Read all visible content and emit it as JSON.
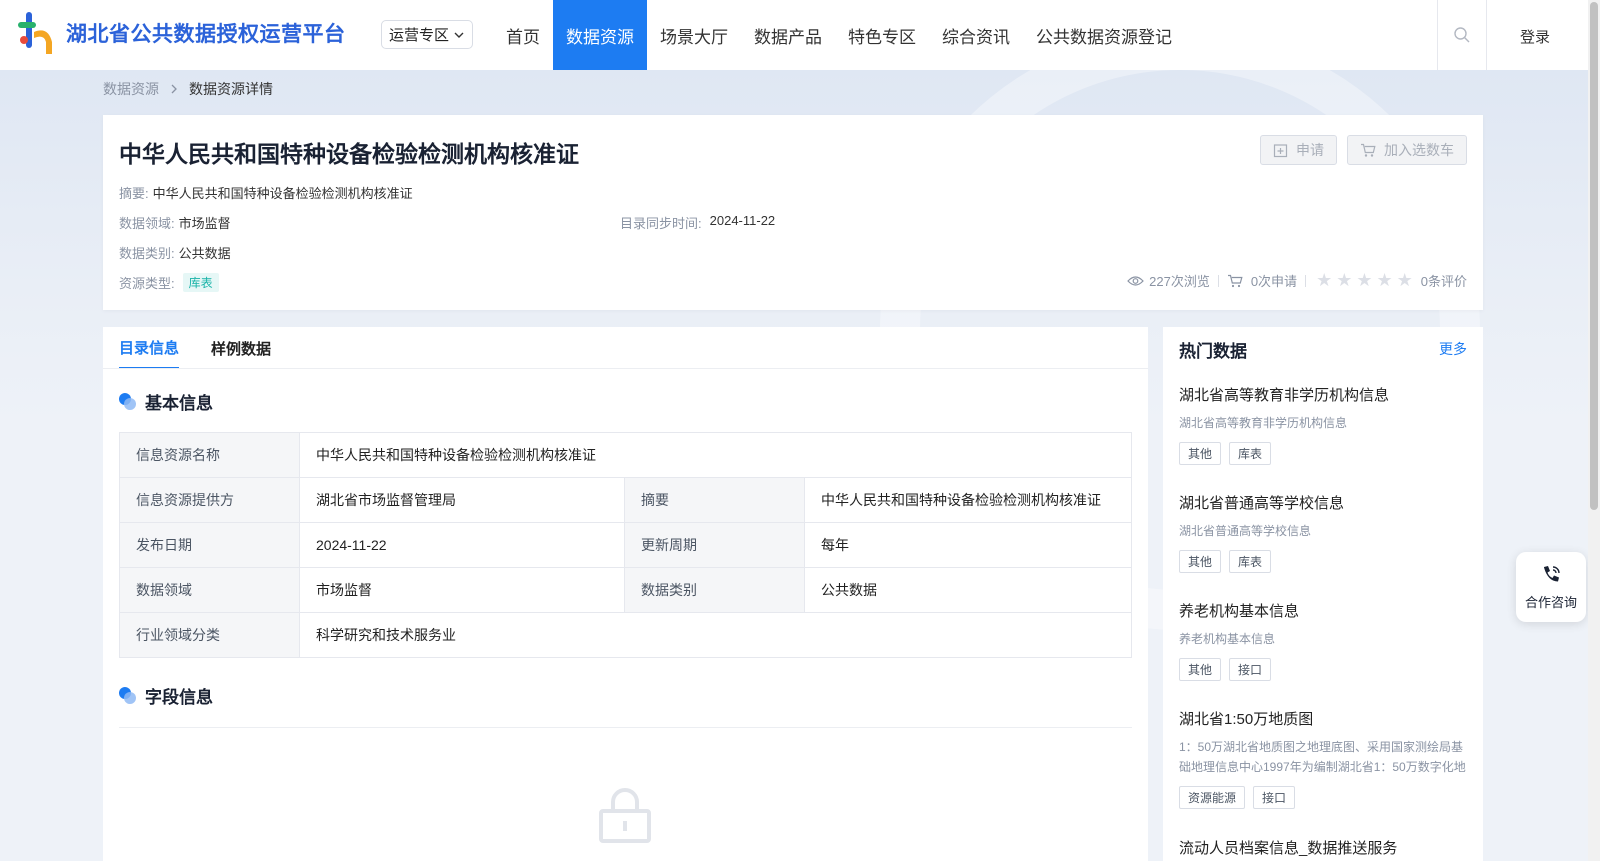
{
  "header": {
    "logo_text": "湖北省公共数据授权运营平台",
    "zone_select": "运营专区",
    "nav": [
      "首页",
      "数据资源",
      "场景大厅",
      "数据产品",
      "特色专区",
      "综合资讯",
      "公共数据资源登记"
    ],
    "active_nav": "数据资源",
    "login": "登录"
  },
  "breadcrumb": {
    "parent": "数据资源",
    "current": "数据资源详情"
  },
  "summary": {
    "title": "中华人民共和国特种设备检验检测机构核准证",
    "apply_btn": "申请",
    "cart_btn": "加入选数车",
    "abstract_label": "摘要:",
    "abstract_value": "中华人民共和国特种设备检验检测机构核准证",
    "domain_label": "数据领域:",
    "domain_value": "市场监督",
    "sync_label": "目录同步时间:",
    "sync_value": "2024-11-22",
    "category_label": "数据类别:",
    "category_value": "公共数据",
    "type_label": "资源类型:",
    "type_value": "库表",
    "views": "227次浏览",
    "applies": "0次申请",
    "rating_value": 0,
    "reviews": "0条评价"
  },
  "tabs": [
    "目录信息",
    "样例数据"
  ],
  "basic_info": {
    "title": "基本信息",
    "rows": {
      "name_k": "信息资源名称",
      "name_v": "中华人民共和国特种设备检验检测机构核准证",
      "provider_k": "信息资源提供方",
      "provider_v": "湖北省市场监督管理局",
      "abstract_k": "摘要",
      "abstract_v": "中华人民共和国特种设备检验检测机构核准证",
      "date_k": "发布日期",
      "date_v": "2024-11-22",
      "cycle_k": "更新周期",
      "cycle_v": "每年",
      "domain_k": "数据领域",
      "domain_v": "市场监督",
      "cat_k": "数据类别",
      "cat_v": "公共数据",
      "industry_k": "行业领域分类",
      "industry_v": "科学研究和技术服务业"
    }
  },
  "field_info": {
    "title": "字段信息"
  },
  "hot": {
    "title": "热门数据",
    "more": "更多",
    "items": [
      {
        "title": "湖北省高等教育非学历机构信息",
        "desc": "湖北省高等教育非学历机构信息",
        "tags": [
          "其他",
          "库表"
        ]
      },
      {
        "title": "湖北省普通高等学校信息",
        "desc": "湖北省普通高等学校信息",
        "tags": [
          "其他",
          "库表"
        ]
      },
      {
        "title": "养老机构基本信息",
        "desc": "养老机构基本信息",
        "tags": [
          "其他",
          "接口"
        ]
      },
      {
        "title": "湖北省1:50万地质图",
        "desc": "1：50万湖北省地质图之地理底图、采用国家测绘局基础地理信息中心1997年为编制湖北省1：50万数字化地",
        "tags": [
          "资源能源",
          "接口"
        ]
      },
      {
        "title": "流动人员档案信息_数据推送服务",
        "desc": "",
        "tags": []
      }
    ]
  },
  "consult": "合作咨询"
}
